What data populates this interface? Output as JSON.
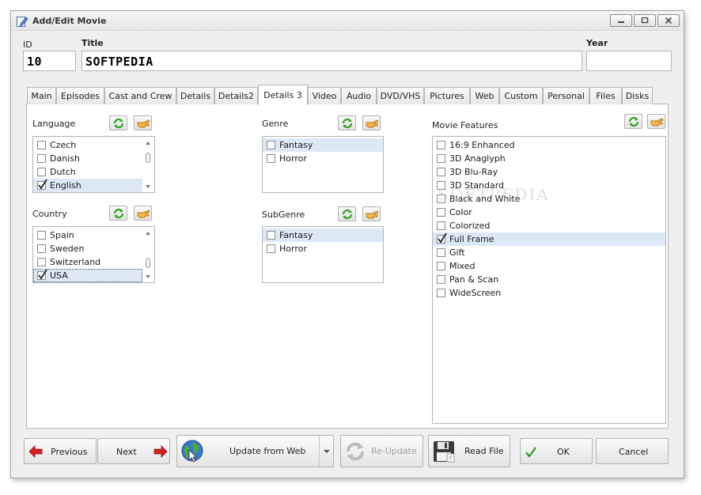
{
  "window": {
    "title": "Add/Edit Movie"
  },
  "fields": {
    "id_label": "ID",
    "id_value": "10",
    "title_label": "Title",
    "title_value": "SOFTPEDIA",
    "year_label": "Year",
    "year_value": ""
  },
  "tabs": [
    {
      "label": "Main"
    },
    {
      "label": "Episodes"
    },
    {
      "label": "Cast and Crew"
    },
    {
      "label": "Details"
    },
    {
      "label": "Details2"
    },
    {
      "label": "Details 3",
      "active": true
    },
    {
      "label": "Video"
    },
    {
      "label": "Audio"
    },
    {
      "label": "DVD/VHS"
    },
    {
      "label": "Pictures"
    },
    {
      "label": "Web"
    },
    {
      "label": "Custom"
    },
    {
      "label": "Personal"
    },
    {
      "label": "Files"
    },
    {
      "label": "Disks"
    }
  ],
  "sections": {
    "language": {
      "label": "Language",
      "items": [
        {
          "label": "Czech",
          "checked": false
        },
        {
          "label": "Danish",
          "checked": false
        },
        {
          "label": "Dutch",
          "checked": false
        },
        {
          "label": "English",
          "checked": true,
          "selected": true
        }
      ]
    },
    "country": {
      "label": "Country",
      "items": [
        {
          "label": "Spain",
          "checked": false
        },
        {
          "label": "Sweden",
          "checked": false
        },
        {
          "label": "Switzerland",
          "checked": false
        },
        {
          "label": "USA",
          "checked": true,
          "selected": true
        }
      ]
    },
    "genre": {
      "label": "Genre",
      "items": [
        {
          "label": "Fantasy",
          "checked": false,
          "selected": true
        },
        {
          "label": "Horror",
          "checked": false
        }
      ]
    },
    "subgenre": {
      "label": "SubGenre",
      "items": [
        {
          "label": "Fantasy",
          "checked": false,
          "selected": true
        },
        {
          "label": "Horror",
          "checked": false
        }
      ]
    },
    "features": {
      "label": "Movie Features",
      "items": [
        {
          "label": "16:9 Enhanced",
          "checked": false
        },
        {
          "label": "3D Anaglyph",
          "checked": false
        },
        {
          "label": "3D Blu-Ray",
          "checked": false
        },
        {
          "label": "3D Standard",
          "checked": false
        },
        {
          "label": "Black and White",
          "checked": false
        },
        {
          "label": "Color",
          "checked": false
        },
        {
          "label": "Colorized",
          "checked": false
        },
        {
          "label": "Full Frame",
          "checked": true,
          "selected": true
        },
        {
          "label": "Gift",
          "checked": false
        },
        {
          "label": "Mixed",
          "checked": false
        },
        {
          "label": "Pan & Scan",
          "checked": false
        },
        {
          "label": "WideScreen",
          "checked": false
        }
      ]
    }
  },
  "buttons": {
    "previous": "Previous",
    "next": "Next",
    "update_web": "Update from Web",
    "reupdate": "Re-Update",
    "read_file": "Read File",
    "ok": "OK",
    "cancel": "Cancel"
  },
  "watermark": "SOFTPEDIA",
  "colors": {
    "selection": "#dde8f7",
    "refresh_icon": "#3aa52e",
    "edit_icon": "#e8a93a",
    "arrow_red": "#d32222"
  }
}
